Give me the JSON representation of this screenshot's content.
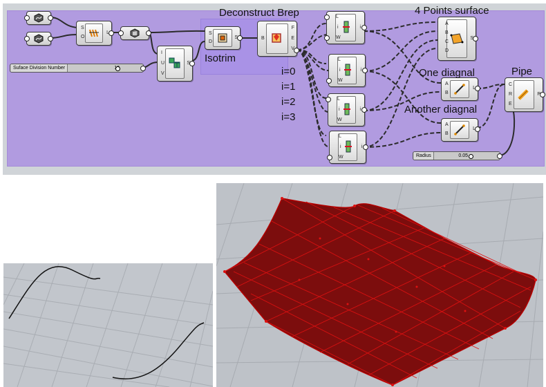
{
  "labels": {
    "deconstruct": "Deconstruct Brep",
    "four_points": "4 Points surface",
    "isotrim": "Isotrim",
    "one_diagonal": "One diagnal",
    "another_diagonal": "Another diagnal",
    "pipe": "Pipe",
    "i0": "i=0",
    "i1": "i=1",
    "i2": "i=2",
    "i3": "i=3"
  },
  "sliders": {
    "division": {
      "name": "Suface Division Number",
      "value": "12"
    },
    "radius": {
      "name": "Radius",
      "value": "0.05"
    }
  },
  "ports": {
    "loft_in": [
      "S",
      "O"
    ],
    "loft_out": "L",
    "divide_in": [
      "I",
      "U",
      "V"
    ],
    "divide_out": "S",
    "iso_in": [
      "S",
      "D"
    ],
    "iso_out": "S",
    "dbrep_in": "B",
    "dbrep_out": [
      "F",
      "E",
      "V"
    ],
    "item_in": [
      "L",
      "i",
      "W"
    ],
    "item_out": "i",
    "srf_in": [
      "A",
      "B",
      "C",
      "D"
    ],
    "srf_out": "S",
    "line_in": [
      "A",
      "B"
    ],
    "line_out": "L",
    "pipe_in": [
      "C",
      "R",
      "E"
    ],
    "pipe_out": "P"
  },
  "colors": {
    "group": "#b19be0",
    "wire": "#2b2b2b",
    "mesh": "#b30000"
  }
}
